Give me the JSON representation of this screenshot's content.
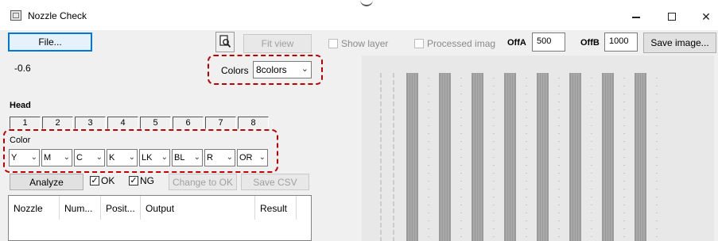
{
  "window": {
    "title": "Nozzle Check"
  },
  "toolbar": {
    "file_label": "File...",
    "fit_view_label": "Fit view",
    "show_layer_label": "Show layer",
    "processed_image_label": "Processed imag",
    "offa_label": "OffA",
    "offa_value": "500",
    "offb_label": "OffB",
    "offb_value": "1000",
    "save_image_label": "Save image..."
  },
  "readout": {
    "value": "-0.6"
  },
  "colors": {
    "label": "Colors",
    "selected": "8colors"
  },
  "head": {
    "label": "Head",
    "buttons": [
      "1",
      "2",
      "3",
      "4",
      "5",
      "6",
      "7",
      "8"
    ]
  },
  "color": {
    "label": "Color",
    "selects": [
      "Y",
      "M",
      "C",
      "K",
      "LK",
      "BL",
      "R",
      "OR"
    ]
  },
  "actions": {
    "analyze_label": "Analyze",
    "ok_label": "OK",
    "ok_checked": true,
    "ng_label": "NG",
    "ng_checked": true,
    "change_to_ok_label": "Change to OK",
    "save_csv_label": "Save CSV"
  },
  "table": {
    "columns": [
      "Nozzle",
      "Num...",
      "Posit...",
      "Output",
      "Result"
    ]
  },
  "preview": {
    "stripe_count": 8,
    "background": "#e8e8e8",
    "stripe_color": "#9a9a9a"
  },
  "icons": [
    "app-icon",
    "magnifier-view-icon",
    "chevron-down-icon",
    "checkmark-icon"
  ]
}
